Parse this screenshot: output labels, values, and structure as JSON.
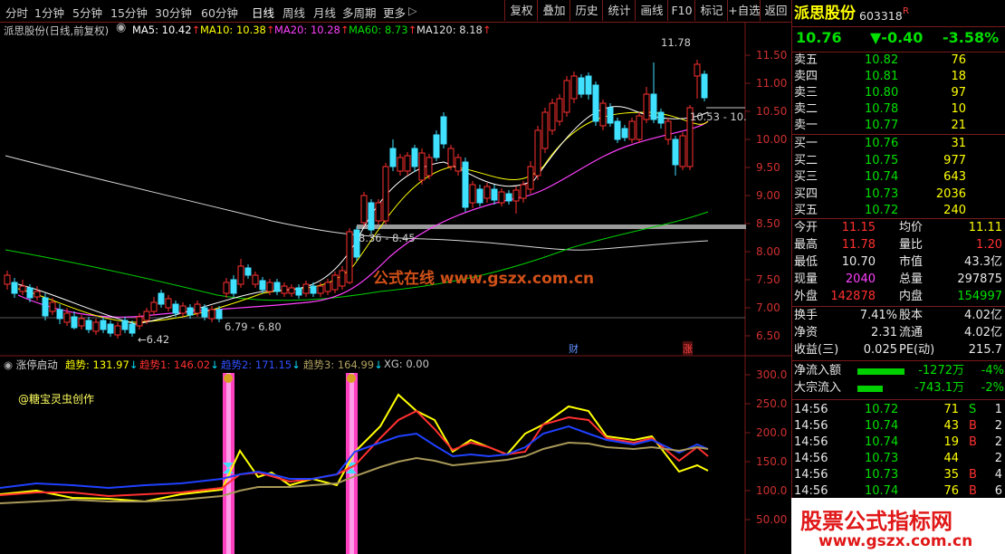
{
  "toolbar": {
    "periods": [
      "分时",
      "1分钟",
      "5分钟",
      "15分钟",
      "30分钟",
      "60分钟",
      "日线",
      "周线",
      "月线",
      "多周期",
      "更多"
    ],
    "active_period": "日线",
    "more_arrow": "▷",
    "buttons": [
      "复权",
      "叠加",
      "历史",
      "统计",
      "画线",
      "F10",
      "标记",
      "+自选",
      "返回"
    ]
  },
  "main_legend": {
    "title": "派思股份(日线,前复权)",
    "ma": [
      {
        "label": "MA5: 10.42",
        "arrow": "↑",
        "color": "#ffffff"
      },
      {
        "label": "MA10: 10.38",
        "arrow": "↑",
        "color": "#ffff00"
      },
      {
        "label": "MA20: 10.28",
        "arrow": "↑",
        "color": "#ff40ff"
      },
      {
        "label": "MA60: 8.73",
        "arrow": "↑",
        "color": "#00e000"
      },
      {
        "label": "MA120: 8.18",
        "arrow": "↑",
        "color": "#e0e0e0"
      }
    ]
  },
  "price_axis": [
    "11.50",
    "11.00",
    "10.50",
    "10.00",
    "9.50",
    "9.00",
    "8.50",
    "8.00",
    "7.50",
    "7.00",
    "6.50"
  ],
  "annotations": {
    "high": "11.78",
    "low": "6.42",
    "range_a": "8.36 - 8.45",
    "range_b": "6.79 - 6.80",
    "range_c": "10.53 - 10.",
    "tag_cai": "财",
    "tag_zhang": "涨",
    "watermark": "公式在线 www.gszx.com.cn"
  },
  "sub_legend": {
    "title": "涨停启动",
    "items": [
      {
        "label": "趋势: 131.97",
        "arrow": "↓",
        "color": "#ffff00"
      },
      {
        "label": "趋势1: 146.02",
        "arrow": "↓",
        "color": "#ff3030"
      },
      {
        "label": "趋势2: 171.15",
        "arrow": "↓",
        "color": "#3050ff"
      },
      {
        "label": "趋势3: 164.99",
        "arrow": "↓",
        "color": "#b0a060"
      },
      {
        "label": "XG: 0.00",
        "arrow": "",
        "color": "#c8c8c8"
      }
    ],
    "author": "@糖宝灵虫创作",
    "axis": [
      "300.0",
      "250.0",
      "200.0",
      "150.0",
      "100.0",
      "50.00"
    ]
  },
  "quote": {
    "name": "派思股份",
    "code": "603318",
    "flag": "R",
    "price": "10.76",
    "change": "▼-0.40",
    "change_pct": "-3.58%",
    "asks": [
      {
        "label": "卖五",
        "price": "10.82",
        "vol": "76"
      },
      {
        "label": "卖四",
        "price": "10.81",
        "vol": "18"
      },
      {
        "label": "卖三",
        "price": "10.80",
        "vol": "97"
      },
      {
        "label": "卖二",
        "price": "10.78",
        "vol": "10"
      },
      {
        "label": "卖一",
        "price": "10.77",
        "vol": "21"
      }
    ],
    "bids": [
      {
        "label": "买一",
        "price": "10.76",
        "vol": "31"
      },
      {
        "label": "买二",
        "price": "10.75",
        "vol": "977"
      },
      {
        "label": "买三",
        "price": "10.74",
        "vol": "643"
      },
      {
        "label": "买四",
        "price": "10.73",
        "vol": "2036"
      },
      {
        "label": "买五",
        "price": "10.72",
        "vol": "240"
      }
    ],
    "stats": [
      {
        "l1": "今开",
        "v1": "11.15",
        "c1": "red",
        "l2": "均价",
        "v2": "11.11",
        "c2": "yellow"
      },
      {
        "l1": "最高",
        "v1": "11.78",
        "c1": "red",
        "l2": "量比",
        "v2": "1.20",
        "c2": "red"
      },
      {
        "l1": "最低",
        "v1": "10.70",
        "c1": "white",
        "l2": "市值",
        "v2": "43.3亿",
        "c2": "white"
      },
      {
        "l1": "现量",
        "v1": "2040",
        "c1": "magenta",
        "l2": "总量",
        "v2": "297875",
        "c2": "white"
      },
      {
        "l1": "外盘",
        "v1": "142878",
        "c1": "red",
        "l2": "内盘",
        "v2": "154997",
        "c2": "green"
      }
    ],
    "fundamentals": [
      {
        "l1": "换手",
        "v1": "7.41%",
        "l2": "股本",
        "v2": "4.02亿"
      },
      {
        "l1": "净资",
        "v1": "2.31",
        "l2": "流通",
        "v2": "4.02亿"
      },
      {
        "l1": "收益(三)",
        "v1": "0.025",
        "l2": "PE(动)",
        "v2": "215.7"
      }
    ],
    "flows": [
      {
        "label": "净流入额",
        "value": "-1272万",
        "pct": "-4%"
      },
      {
        "label": "大宗流入",
        "value": "-743.1万",
        "pct": "-2%"
      }
    ],
    "ticks": [
      {
        "time": "14:56",
        "price": "10.72",
        "vol": "71",
        "side": "S",
        "num": "1"
      },
      {
        "time": "14:56",
        "price": "10.74",
        "vol": "43",
        "side": "B",
        "num": "2"
      },
      {
        "time": "14:56",
        "price": "10.74",
        "vol": "19",
        "side": "B",
        "num": "2"
      },
      {
        "time": "14:56",
        "price": "10.73",
        "vol": "44",
        "side": "",
        "num": "2"
      },
      {
        "time": "14:56",
        "price": "10.73",
        "vol": "35",
        "side": "B",
        "num": "4"
      },
      {
        "time": "14:56",
        "price": "10.74",
        "vol": "76",
        "side": "B",
        "num": "6"
      }
    ]
  },
  "ad_banner": {
    "title": "股票公式指标网",
    "url": "www.gszx.com.cn"
  }
}
